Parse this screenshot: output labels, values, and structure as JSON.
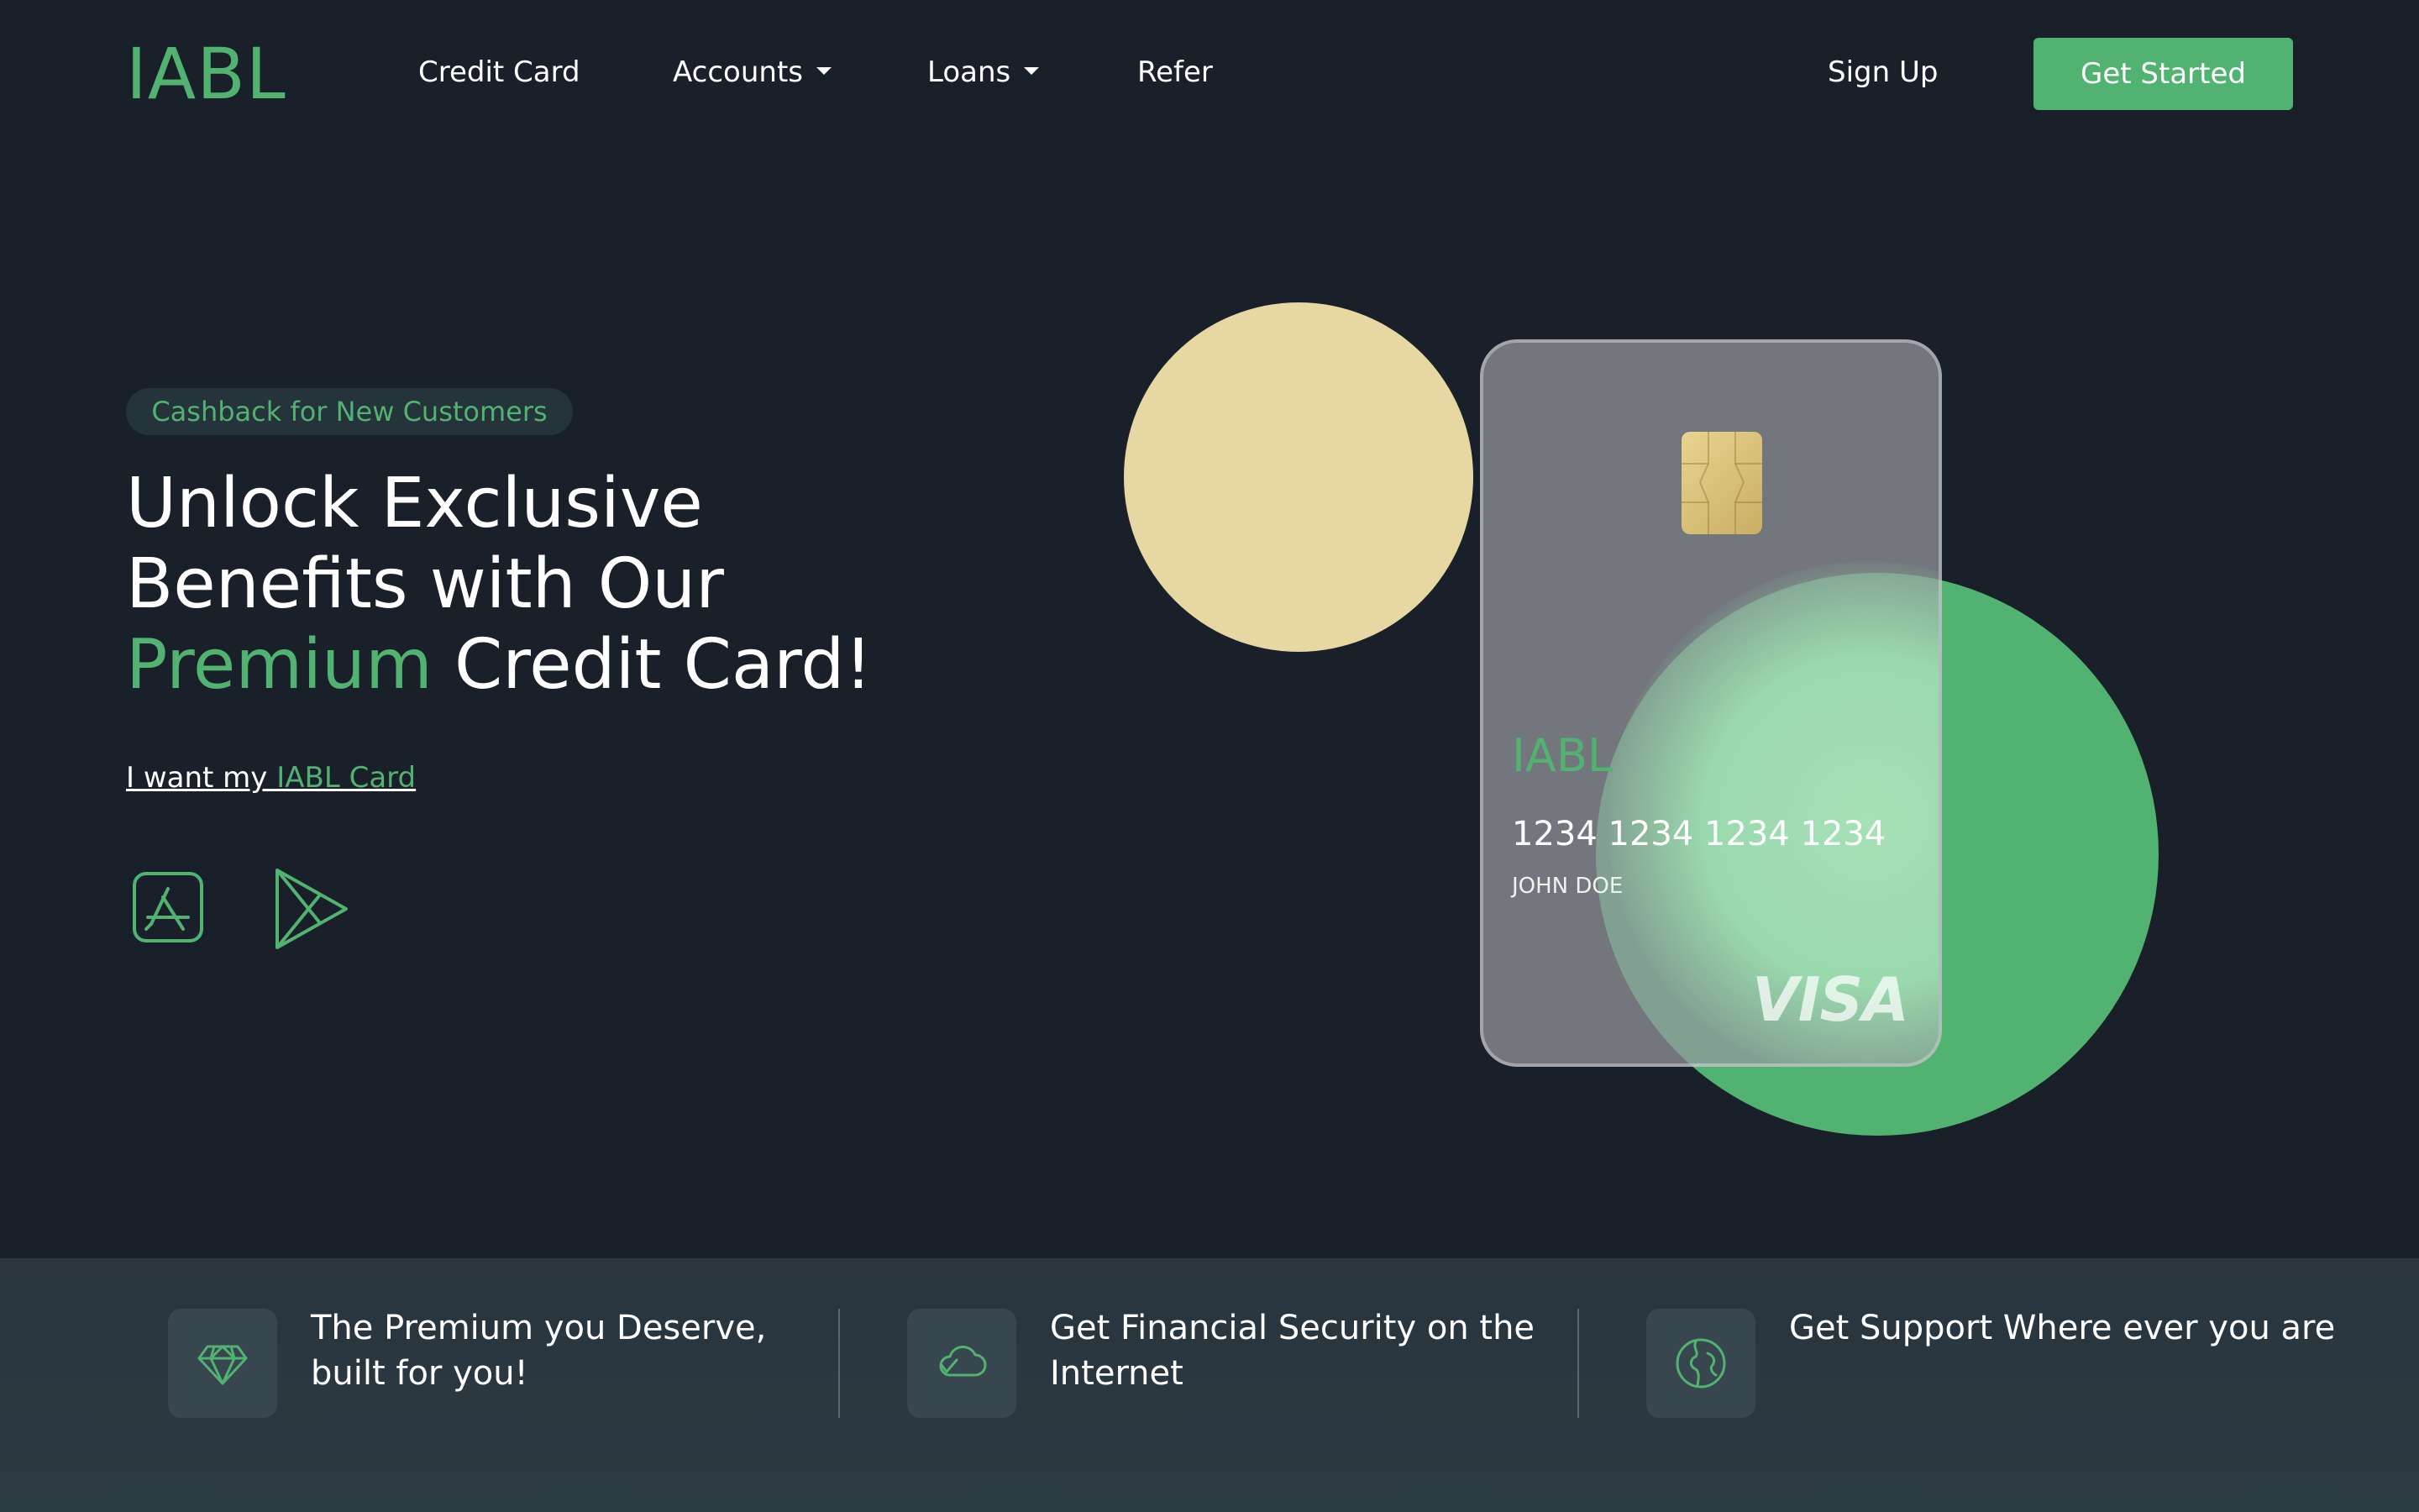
{
  "nav": {
    "logo": "IABL",
    "items": [
      {
        "label": "Credit Card"
      },
      {
        "label": "Accounts"
      },
      {
        "label": "Loans"
      },
      {
        "label": "Refer"
      }
    ],
    "signup_label": "Sign Up",
    "cta_label": "Get Started"
  },
  "hero": {
    "badge": "Cashback for New Customers",
    "headline_line1": "Unlock Exclusive",
    "headline_line2": "Benefits with Our",
    "headline_highlight": "Premium",
    "headline_line3_rest": " Credit Card!",
    "link_prefix": "I want my ",
    "link_highlight": "IABL Card",
    "app_store_icon": "app-store-icon",
    "play_store_icon": "play-store-icon"
  },
  "card": {
    "brand": "IABL",
    "number": "1234 1234 1234 1234",
    "name": "JOHN DOE",
    "network": "VISA"
  },
  "features": [
    {
      "icon": "diamond-icon",
      "text": "The Premium you Deserve, built for you!"
    },
    {
      "icon": "cloud-check-icon",
      "text": "Get Financial Security on the Internet"
    },
    {
      "icon": "globe-icon",
      "text": "Get Support Where ever you are"
    }
  ],
  "colors": {
    "background": "#1a2029",
    "accent": "#51b271",
    "yellow_circle": "#e6d7a3",
    "strip": "#2c3a42"
  }
}
